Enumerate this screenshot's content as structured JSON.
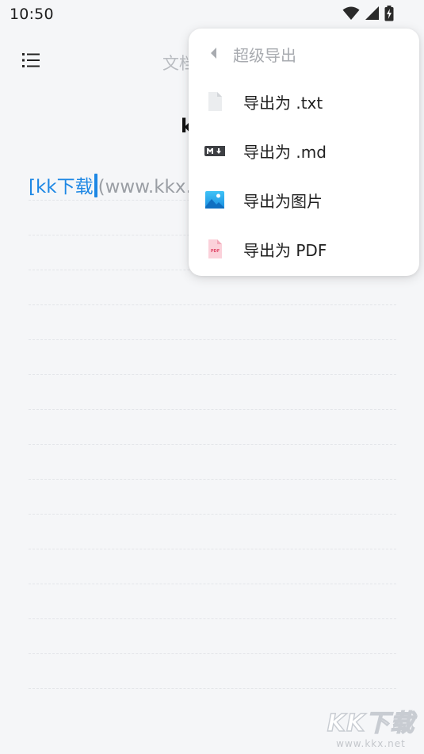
{
  "status": {
    "time": "10:50",
    "icons": [
      "wifi-icon",
      "cell-signal-icon",
      "battery-charging-icon"
    ]
  },
  "topbar": {
    "menu_icon": "list-menu-icon",
    "title_partial": "文档"
  },
  "editor": {
    "heading_partial": "k",
    "link_text": "[kk下载",
    "url_text": "(www.kkx.net)"
  },
  "export_menu": {
    "header_label": "超级导出",
    "header_icon": "back-arrow-icon",
    "items": [
      {
        "icon": "text-file-icon",
        "label": "导出为 .txt"
      },
      {
        "icon": "markdown-icon",
        "label": "导出为 .md"
      },
      {
        "icon": "image-icon",
        "label": "导出为图片"
      },
      {
        "icon": "pdf-icon",
        "label": "导出为 PDF"
      }
    ]
  },
  "watermark": {
    "big": "KK下载",
    "small": "www.kkx.net"
  },
  "colors": {
    "accent": "#1d87e4",
    "background": "#f5f6f8",
    "popup": "#ffffff",
    "muted_text": "#a8abb0"
  }
}
